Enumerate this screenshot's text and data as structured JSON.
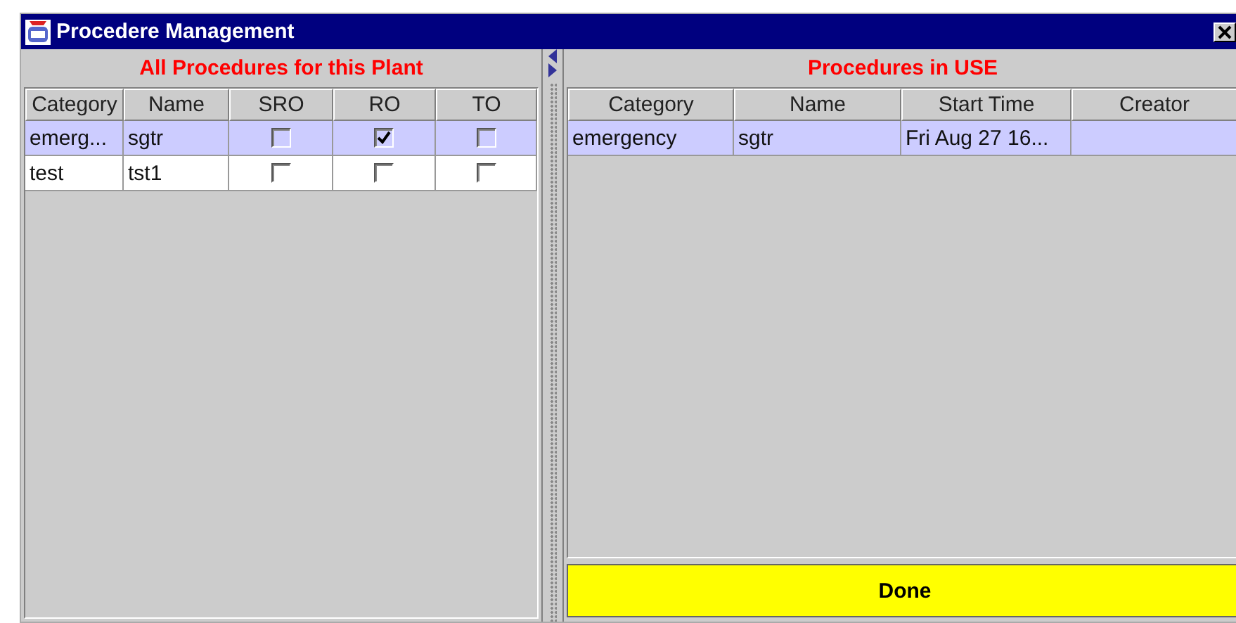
{
  "window": {
    "title": "Procedere Management"
  },
  "plant_procedures": {
    "title": "All Procedures for this Plant",
    "columns": [
      "Category",
      "Name",
      "SRO",
      "RO",
      "TO"
    ],
    "rows": [
      {
        "category": "emerg...",
        "name": "sgtr",
        "sro": false,
        "ro": true,
        "to": false,
        "selected": true
      },
      {
        "category": "test",
        "name": "tst1",
        "sro": false,
        "ro": false,
        "to": false,
        "selected": false
      }
    ]
  },
  "procedures_in_use": {
    "title": "Procedures in USE",
    "columns": [
      "Category",
      "Name",
      "Start Time",
      "Creator"
    ],
    "rows": [
      {
        "category": "emergency",
        "name": "sgtr",
        "start_time": "Fri Aug 27 16...",
        "selected": true
      }
    ]
  },
  "buttons": [
    "Done"
  ]
}
